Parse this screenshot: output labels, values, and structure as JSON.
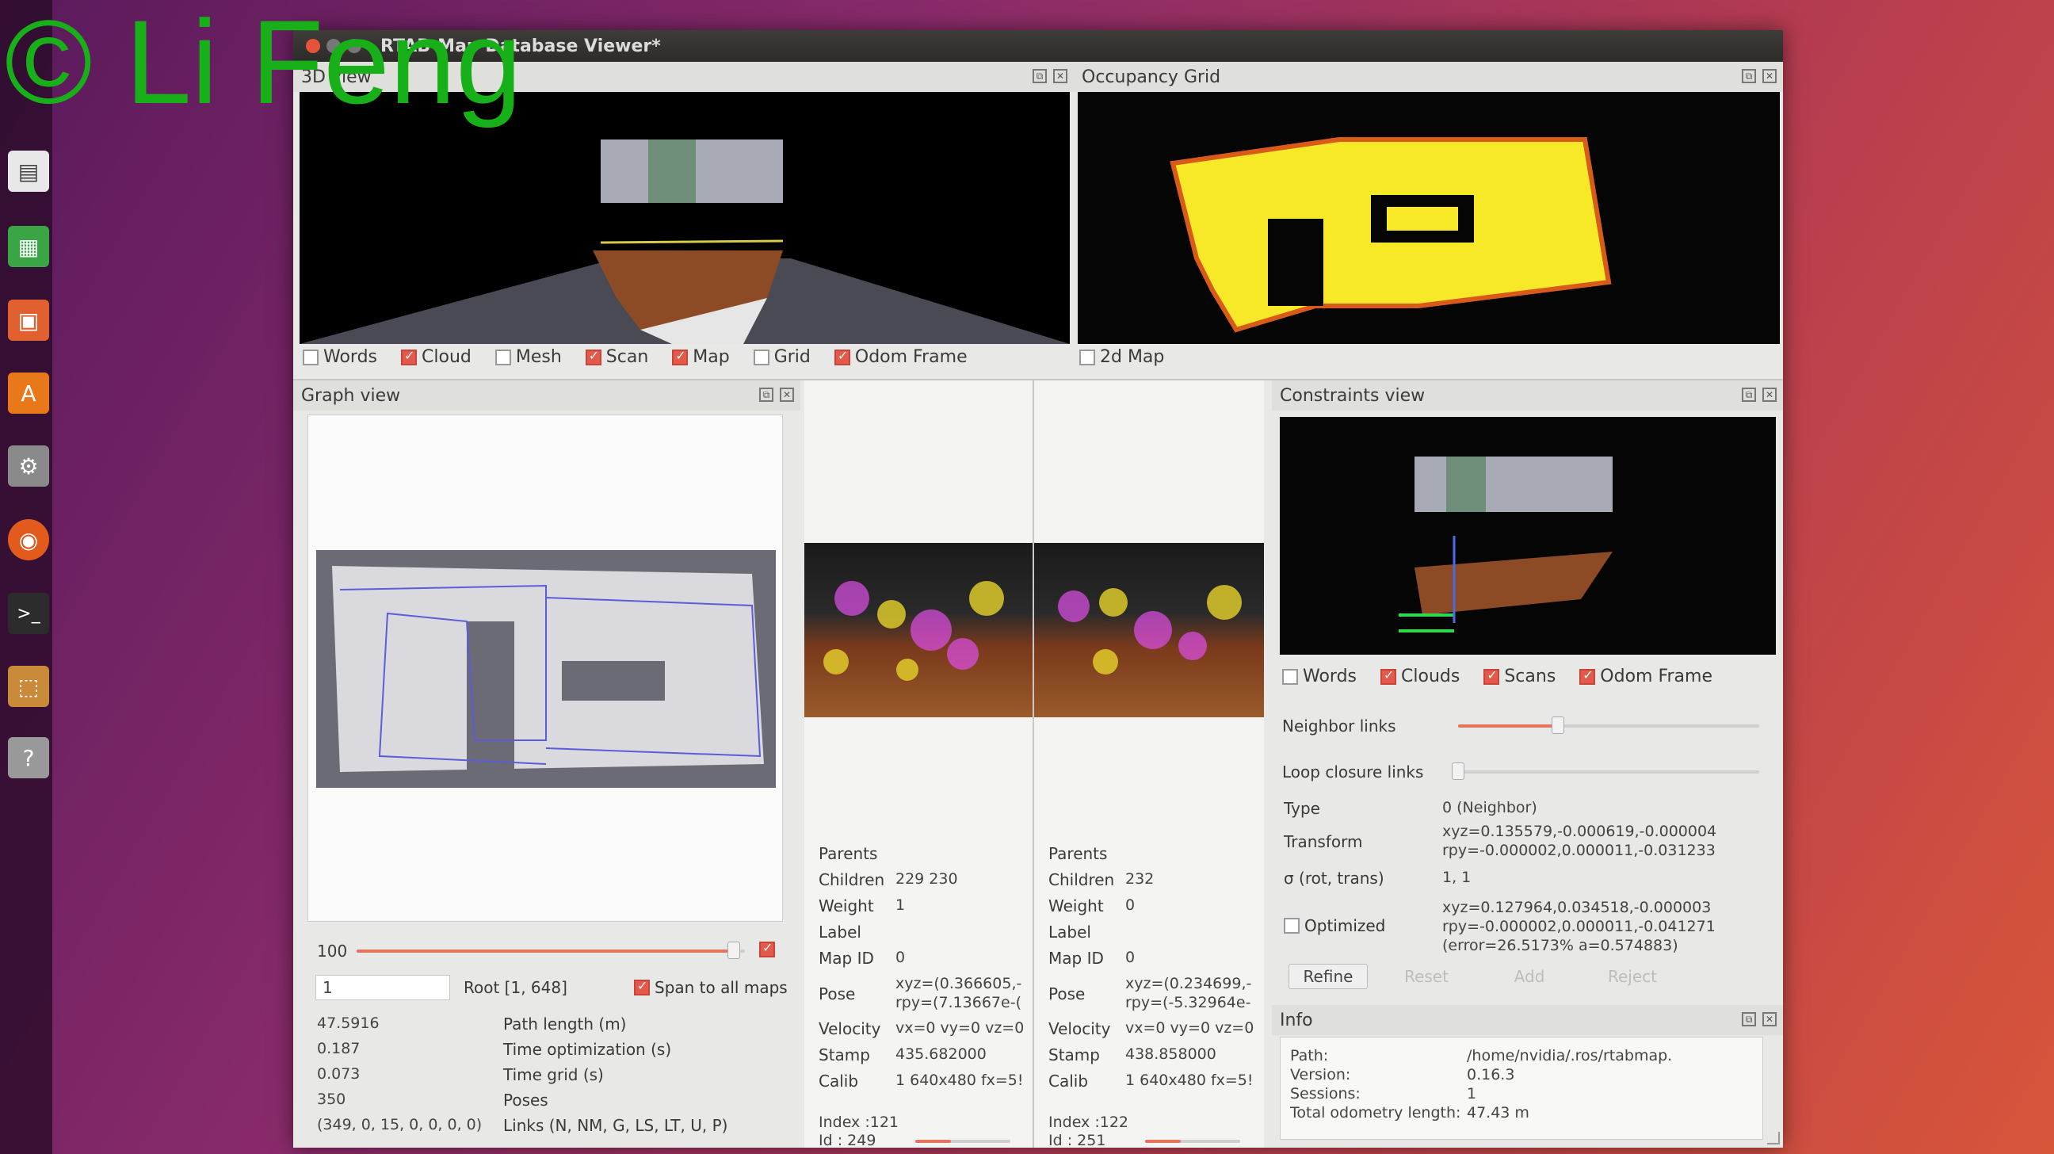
{
  "watermark": "© Li Feng",
  "window": {
    "title": "RTAB-Map Database Viewer*"
  },
  "view3d": {
    "title": "3D view",
    "checkboxes": [
      {
        "label": "Words",
        "checked": false
      },
      {
        "label": "Cloud",
        "checked": true
      },
      {
        "label": "Mesh",
        "checked": false
      },
      {
        "label": "Scan",
        "checked": true
      },
      {
        "label": "Map",
        "checked": true
      },
      {
        "label": "Grid",
        "checked": false
      },
      {
        "label": "Odom Frame",
        "checked": true
      }
    ]
  },
  "occupancy": {
    "title": "Occupancy Grid",
    "checkbox": {
      "label": "2d Map",
      "checked": false
    }
  },
  "graph": {
    "title": "Graph view",
    "slider_value": "100",
    "node_input": "1",
    "root_label": "Root [1, 648]",
    "span_label": "Span to all maps",
    "span_checked": true,
    "stats": [
      {
        "value": "47.5916",
        "label": "Path length (m)"
      },
      {
        "value": "0.187",
        "label": "Time optimization (s)"
      },
      {
        "value": "0.073",
        "label": "Time grid (s)"
      },
      {
        "value": "350",
        "label": "Poses"
      },
      {
        "value": "(349, 0, 15, 0, 0, 0, 0)",
        "label": "Links (N, NM, G, LS, LT, U, P)"
      }
    ]
  },
  "node_a": {
    "fields": [
      {
        "label": "Parents",
        "value": ""
      },
      {
        "label": "Children",
        "value": "229 230"
      },
      {
        "label": "Weight",
        "value": "1"
      },
      {
        "label": "Label",
        "value": ""
      },
      {
        "label": "Map ID",
        "value": "0"
      },
      {
        "label": "Pose",
        "value": "xyz=(0.366605,-",
        "value2": "rpy=(7.13667e-("
      },
      {
        "label": "Velocity",
        "value": "vx=0 vy=0 vz=0"
      },
      {
        "label": "Stamp",
        "value": "435.682000"
      },
      {
        "label": "Calib",
        "value": "1 640x480 fx=5!"
      }
    ],
    "index": "Index :121",
    "id": "Id :   249"
  },
  "node_b": {
    "fields": [
      {
        "label": "Parents",
        "value": ""
      },
      {
        "label": "Children",
        "value": "232"
      },
      {
        "label": "Weight",
        "value": "0"
      },
      {
        "label": "Label",
        "value": ""
      },
      {
        "label": "Map ID",
        "value": "0"
      },
      {
        "label": "Pose",
        "value": "xyz=(0.234699,-",
        "value2": "rpy=(-5.32964e-"
      },
      {
        "label": "Velocity",
        "value": "vx=0 vy=0 vz=0"
      },
      {
        "label": "Stamp",
        "value": "438.858000"
      },
      {
        "label": "Calib",
        "value": "1 640x480 fx=5!"
      }
    ],
    "index": "Index :122",
    "id": "Id :   251"
  },
  "constraints": {
    "title": "Constraints view",
    "checkboxes": [
      {
        "label": "Words",
        "checked": false
      },
      {
        "label": "Clouds",
        "checked": true
      },
      {
        "label": "Scans",
        "checked": true
      },
      {
        "label": "Odom Frame",
        "checked": true
      }
    ],
    "neighbor_links": "Neighbor links",
    "loop_closure_links": "Loop closure links",
    "type_label": "Type",
    "type_value": "0 (Neighbor)",
    "transform_label": "Transform",
    "transform_xyz": "xyz=0.135579,-0.000619,-0.000004",
    "transform_rpy": "rpy=-0.000002,0.000011,-0.031233",
    "sigma_label": "σ (rot, trans)",
    "sigma_value": "1, 1",
    "optimized_label": "Optimized",
    "optimized_checked": false,
    "optimized_xyz": "xyz=0.127964,0.034518,-0.000003",
    "optimized_rpy": "rpy=-0.000002,0.000011,-0.041271",
    "optimized_error": "(error=26.5173% a=0.574883)",
    "buttons": {
      "refine": "Refine",
      "reset": "Reset",
      "add": "Add",
      "reject": "Reject"
    }
  },
  "info": {
    "title": "Info",
    "rows": [
      {
        "label": "Path:",
        "value": "/home/nvidia/.ros/rtabmap."
      },
      {
        "label": "Version:",
        "value": "0.16.3"
      },
      {
        "label": "Sessions:",
        "value": "1"
      },
      {
        "label": "Total odometry length:",
        "value": "47.43 m"
      }
    ]
  },
  "launcher_icons": [
    "files-icon",
    "spreadsheet-icon",
    "presentation-icon",
    "software-center-icon",
    "settings-icon",
    "firefox-icon",
    "terminal-icon",
    "package-icon",
    "help-icon"
  ]
}
